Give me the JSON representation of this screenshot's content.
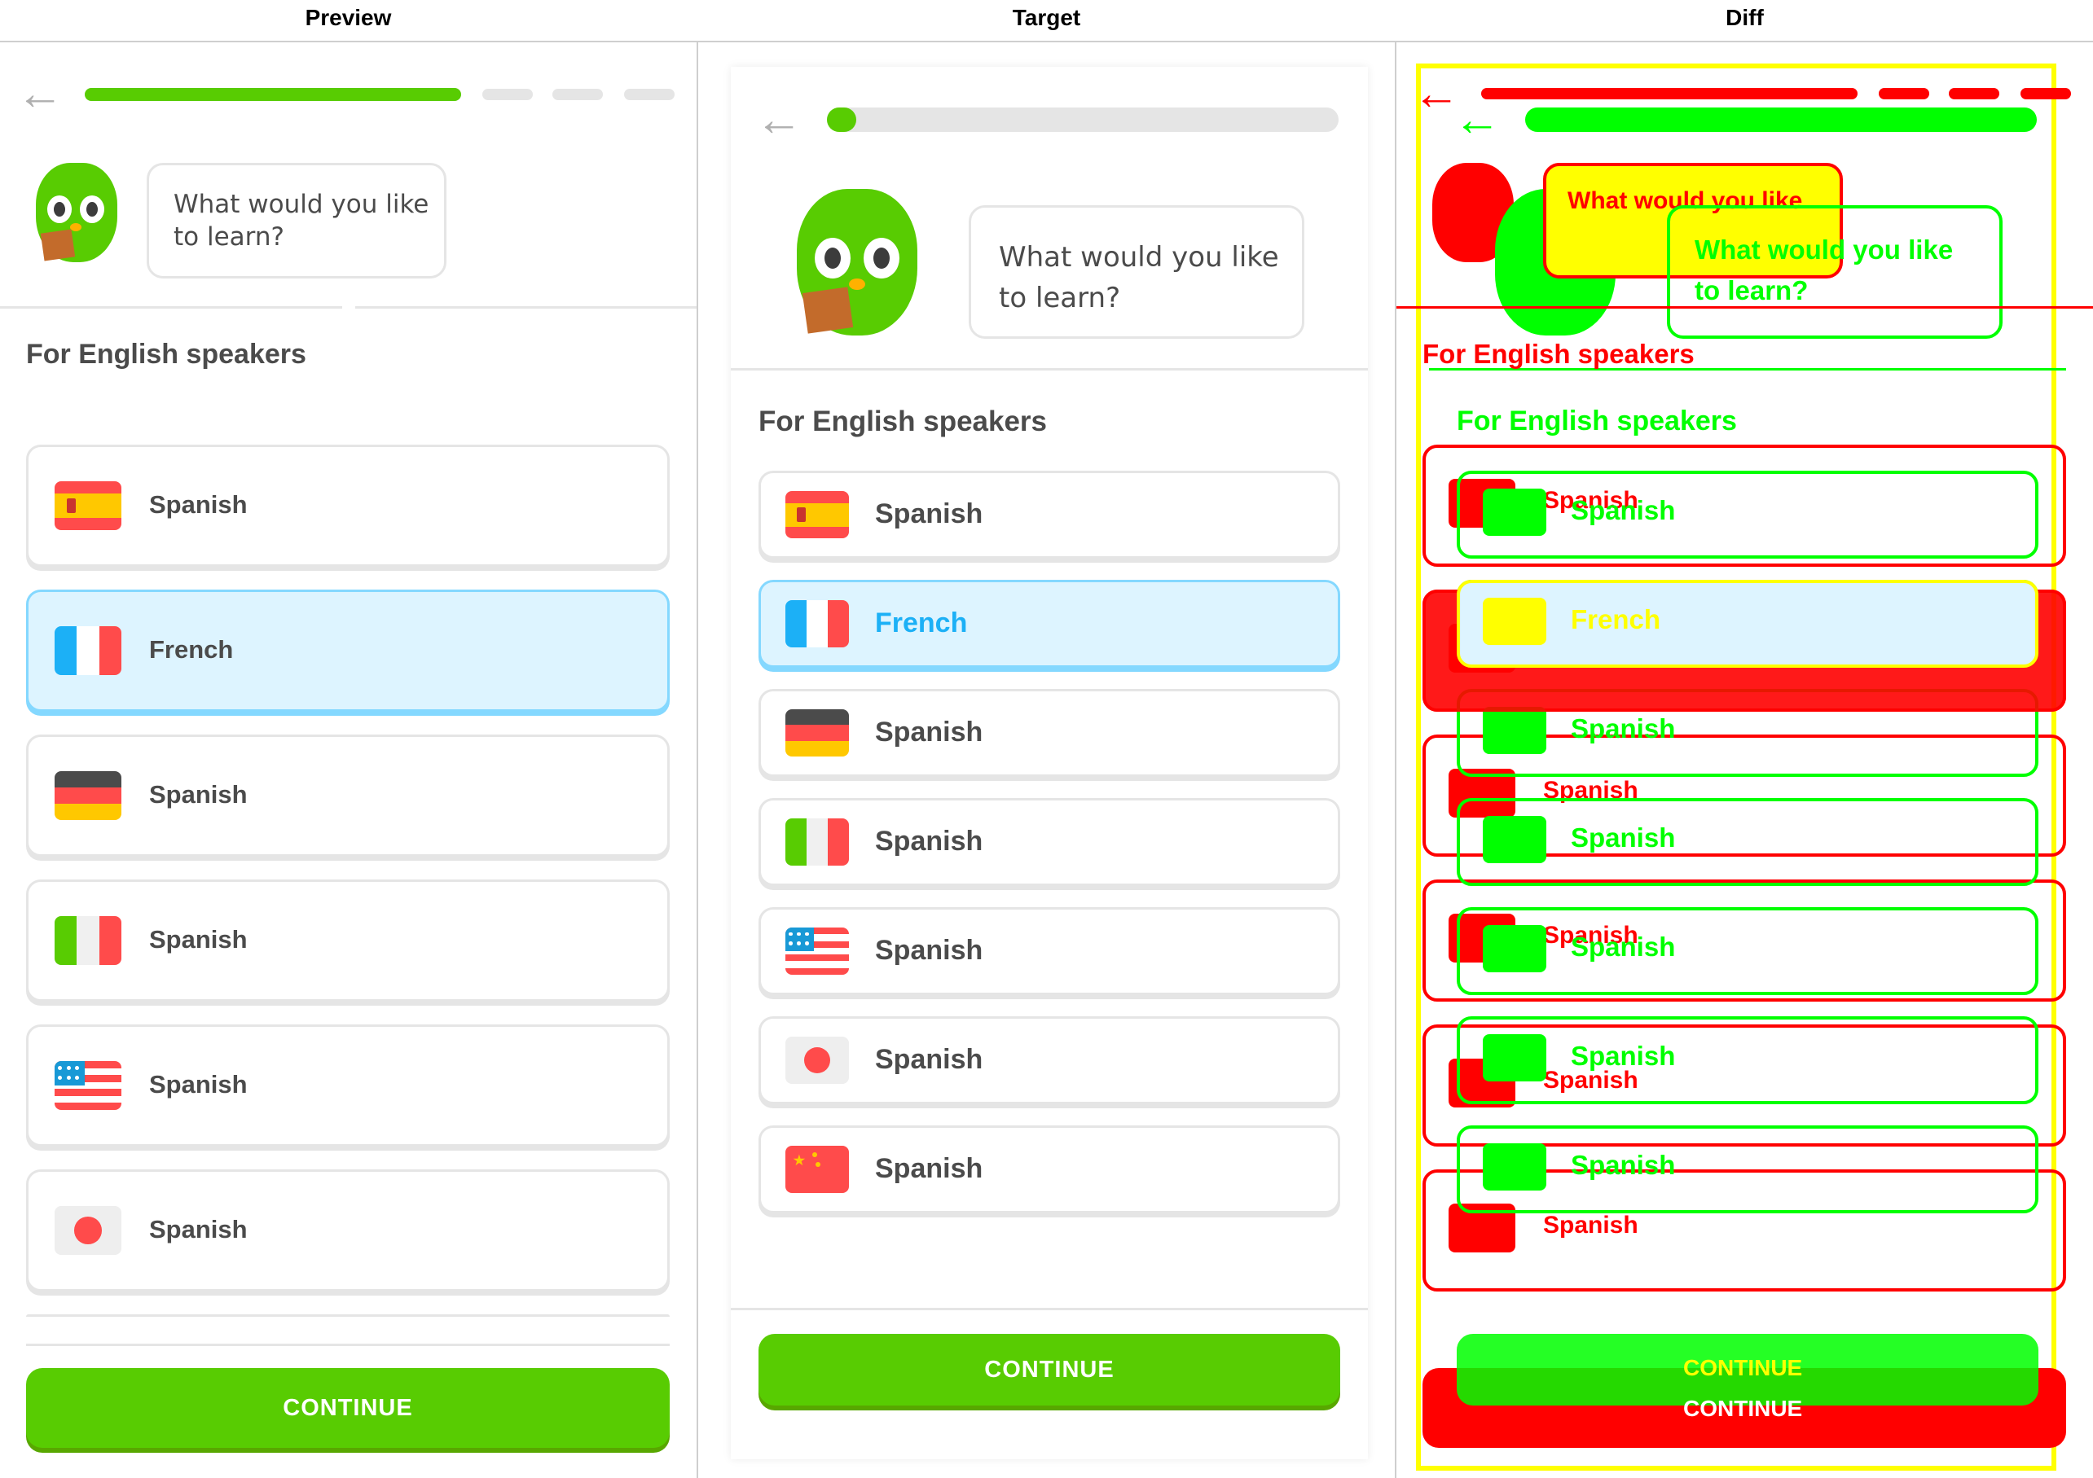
{
  "panel_labels": [
    "Preview",
    "Target",
    "Diff"
  ],
  "back_icon": "←",
  "question": "What would you like to learn?",
  "question_lines": [
    "What would you like",
    "to learn?"
  ],
  "section_title": "For English speakers",
  "options": [
    {
      "label": "Spanish",
      "flag": "spain-flag"
    },
    {
      "label": "French",
      "flag": "france-flag",
      "selected": true
    },
    {
      "label": "Spanish",
      "flag": "germany-flag"
    },
    {
      "label": "Spanish",
      "flag": "italy-flag"
    },
    {
      "label": "Spanish",
      "flag": "usa-flag"
    },
    {
      "label": "Spanish",
      "flag": "japan-flag"
    },
    {
      "label": "Spanish",
      "flag": "china-flag"
    }
  ],
  "continue_label": "CONTINUE",
  "colors": {
    "accent": "#58cc02",
    "selected_bg": "#ddf4ff",
    "selected_border": "#84d8ff",
    "selected_text": "#1cb0f6",
    "text": "#4b4b4b",
    "border": "#e5e5e5"
  }
}
